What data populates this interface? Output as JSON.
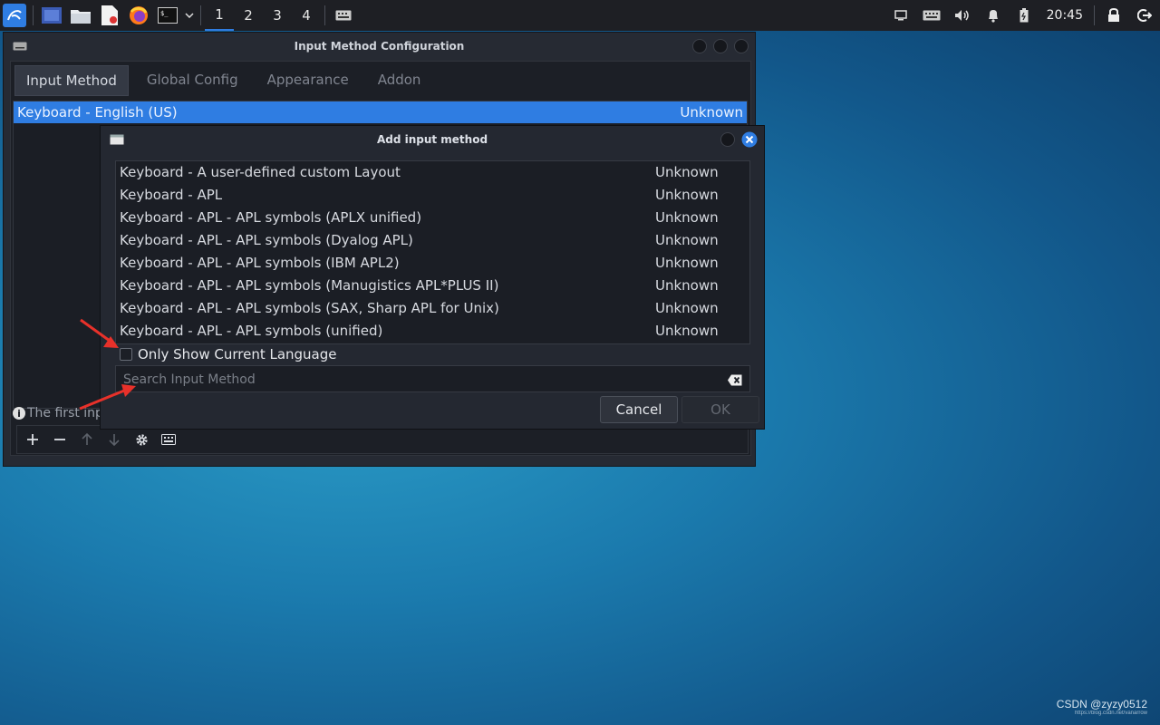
{
  "taskbar": {
    "workspaces": [
      "1",
      "2",
      "3",
      "4"
    ],
    "active_workspace": "1",
    "clock": "20:45",
    "icons": [
      "kali-menu-icon",
      "desktop-icon",
      "file-manager-icon",
      "text-editor-icon",
      "firefox-icon",
      "terminal-icon",
      "chevron-down-icon",
      "keyboard-icon"
    ],
    "tray": [
      "display-icon",
      "keyboard-icon",
      "volume-icon",
      "bell-icon",
      "battery-icon",
      "lock-icon",
      "logout-icon"
    ]
  },
  "main_window": {
    "title": "Input Method Configuration",
    "tabs": [
      {
        "label": "Input Method",
        "active": true
      },
      {
        "label": "Global Config",
        "active": false
      },
      {
        "label": "Appearance",
        "active": false
      },
      {
        "label": "Addon",
        "active": false
      }
    ],
    "list": [
      {
        "name": "Keyboard - English (US)",
        "status": "Unknown",
        "selected": true
      }
    ],
    "info_text": "The first inpu"
  },
  "dialog": {
    "title": "Add input method",
    "items": [
      {
        "name": "Keyboard - A user-defined custom Layout",
        "status": "Unknown"
      },
      {
        "name": "Keyboard - APL",
        "status": "Unknown"
      },
      {
        "name": "Keyboard - APL - APL symbols (APLX unified)",
        "status": "Unknown"
      },
      {
        "name": "Keyboard - APL - APL symbols (Dyalog APL)",
        "status": "Unknown"
      },
      {
        "name": "Keyboard - APL - APL symbols (IBM APL2)",
        "status": "Unknown"
      },
      {
        "name": "Keyboard - APL - APL symbols (Manugistics APL*PLUS II)",
        "status": "Unknown"
      },
      {
        "name": "Keyboard - APL - APL symbols (SAX, Sharp APL for Unix)",
        "status": "Unknown"
      },
      {
        "name": "Keyboard - APL - APL symbols (unified)",
        "status": "Unknown"
      }
    ],
    "only_show_current_language": {
      "label": "Only Show Current Language",
      "checked": false
    },
    "search": {
      "placeholder": "Search Input Method",
      "value": ""
    },
    "cancel_label": "Cancel",
    "ok_label": "OK"
  },
  "watermark": {
    "text": "CSDN @zyzy0512",
    "url": "https://blog.csdn.net/vanarrow"
  },
  "colors": {
    "accent": "#2f7de2",
    "annotation_arrow": "#e8312a"
  }
}
